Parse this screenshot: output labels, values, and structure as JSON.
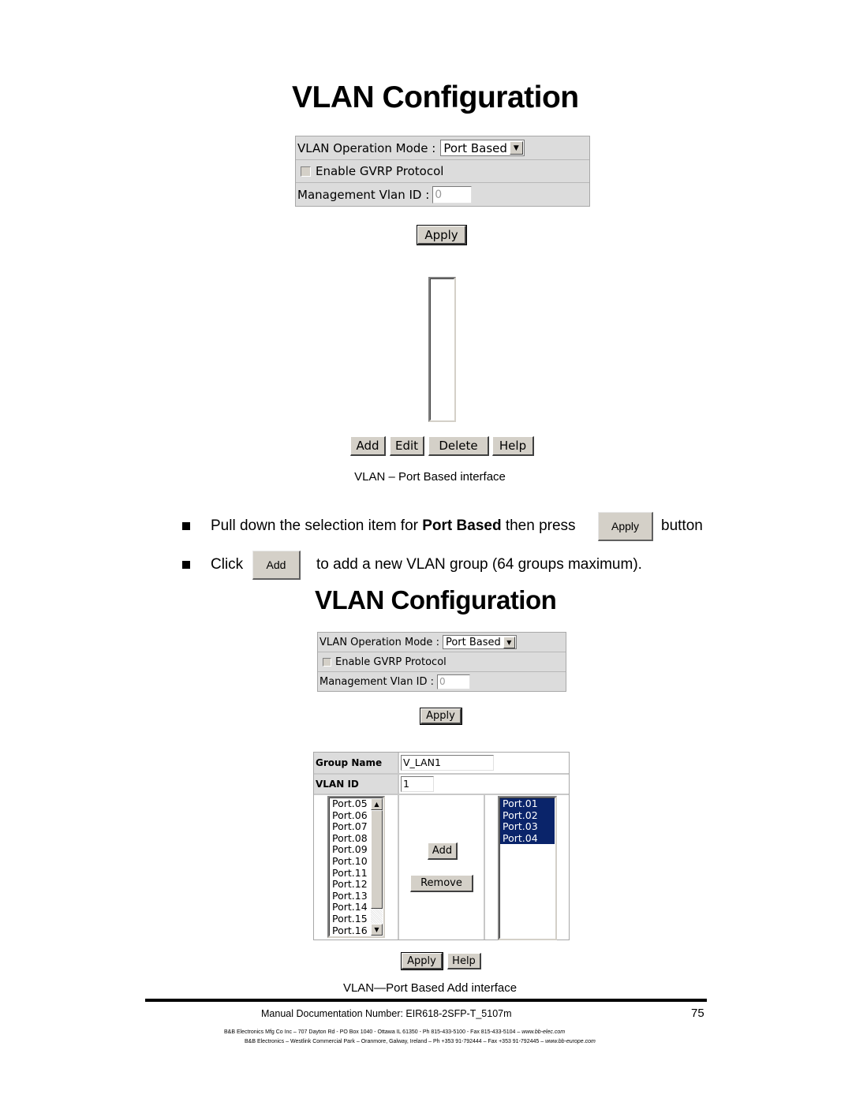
{
  "section1": {
    "title": "VLAN Configuration",
    "operation_mode_label": "VLAN Operation Mode :",
    "operation_mode_value": "Port Based",
    "gvrp_label": "Enable GVRP Protocol",
    "gvrp_checked": false,
    "mgmt_vlan_label": "Management Vlan ID :",
    "mgmt_vlan_value": "0",
    "apply_label": "Apply",
    "vlan_list_items": [],
    "buttons": {
      "add": "Add",
      "edit": "Edit",
      "delete": "Delete",
      "help": "Help"
    },
    "caption": "VLAN – Port Based interface"
  },
  "instructions": {
    "line1_prefix": "Pull down the selection item for ",
    "line1_bold": "Port Based",
    "line1_middle": " then press",
    "line1_button": "Apply",
    "line1_suffix": "button",
    "line2_prefix": "Click",
    "line2_button": "Add",
    "line2_suffix": "to add a new VLAN group (64 groups maximum)."
  },
  "section2": {
    "title": "VLAN Configuration",
    "operation_mode_label": "VLAN Operation Mode :",
    "operation_mode_value": "Port Based",
    "gvrp_label": "Enable GVRP Protocol",
    "gvrp_checked": false,
    "mgmt_vlan_label": "Management Vlan ID :",
    "mgmt_vlan_value": "0",
    "apply_label": "Apply",
    "group_name_label": "Group Name",
    "group_name_value": "V_LAN1",
    "vlan_id_label": "VLAN ID",
    "vlan_id_value": "1",
    "available_ports": [
      "Port.05",
      "Port.06",
      "Port.07",
      "Port.08",
      "Port.09",
      "Port.10",
      "Port.11",
      "Port.12",
      "Port.13",
      "Port.14",
      "Port.15",
      "Port.16"
    ],
    "member_ports": [
      "Port.01",
      "Port.02",
      "Port.03",
      "Port.04"
    ],
    "add_label": "Add",
    "remove_label": "Remove",
    "bottom_apply_label": "Apply",
    "bottom_help_label": "Help",
    "caption": "VLAN—Port Based Add interface"
  },
  "footer": {
    "doc_number": "Manual Documentation Number: EIR618-2SFP-T_5107m",
    "page_number": "75",
    "address_us": "B&B Electronics Mfg Co Inc – 707 Dayton Rd - PO Box 1040 - Ottawa IL 61350 - Ph 815-433-5100 - Fax 815-433-5104 – ",
    "url_us": "www.bb-elec.com",
    "address_eu": "B&B Electronics – Westlink Commercial Park – Oranmore, Galway, Ireland – Ph +353 91-792444 – Fax +353 91-792445 – ",
    "url_eu": "www.bb-europe.com"
  },
  "colors": {
    "selection": "#0a246a",
    "panel_bg": "#dcdcdc",
    "button_face": "#d4d0c8"
  }
}
